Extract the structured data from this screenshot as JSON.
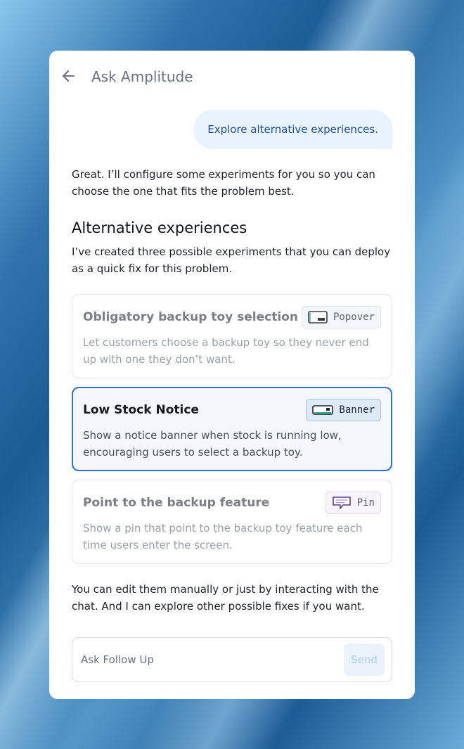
{
  "header": {
    "back_icon": "arrow-left-icon",
    "title": "Ask Amplitude"
  },
  "chat": {
    "user_message": "Explore alternative experiences.",
    "intro": "Great. I’ll configure some experiments for you so you can choose the one that fits the problem best.",
    "section_title": "Alternative experiences",
    "section_intro": "I’ve created three possible experiments that you can deploy as a quick fix for this problem.",
    "experiences": [
      {
        "title": "Obligatory backup toy selection",
        "description": "Let customers choose a backup toy so they never end up with one they don’t want.",
        "tag": "Popover",
        "icon": "popover-icon",
        "selected": false
      },
      {
        "title": "Low Stock Notice",
        "description": "Show a notice banner when stock is running low, encouraging users to select a backup toy.",
        "tag": "Banner",
        "icon": "banner-icon",
        "selected": true
      },
      {
        "title": "Point to the backup feature",
        "description": "Show a pin that point to the backup toy feature each time users enter the screen.",
        "tag": "Pin",
        "icon": "pin-icon",
        "selected": false
      }
    ],
    "closing": "You can edit them manually or just by interacting with the chat. And I can explore other possible fixes if you want."
  },
  "composer": {
    "placeholder": "Ask Follow Up",
    "value": "",
    "send_label": "Send"
  },
  "colors": {
    "accent": "#2f6fdc",
    "user_bubble_bg": "#e8f3fd",
    "user_bubble_text": "#1e4fa3",
    "background": "#1d5e96"
  }
}
